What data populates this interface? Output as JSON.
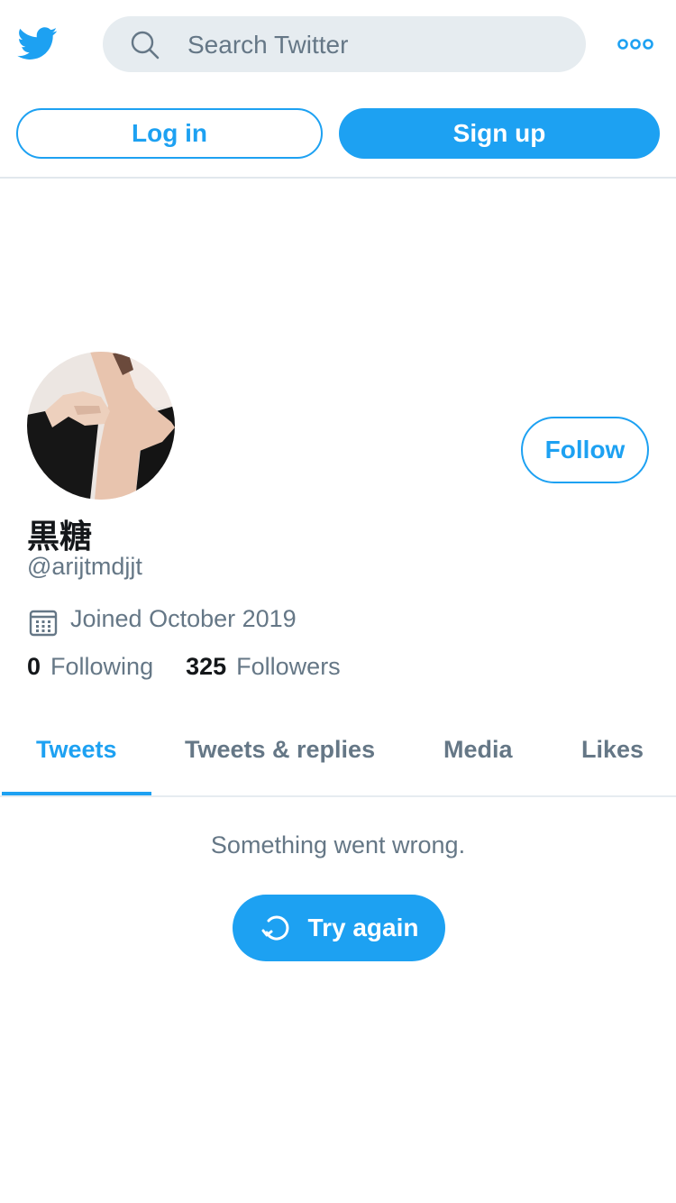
{
  "header": {
    "logo_icon": "twitter-bird-icon",
    "search_placeholder": "Search Twitter",
    "more_icon": "more-dots-icon",
    "accent_color": "#1da1f2"
  },
  "auth": {
    "login_label": "Log in",
    "signup_label": "Sign up"
  },
  "profile": {
    "display_name": "黒糖",
    "handle": "@arijtmdjjt",
    "joined": "Joined October 2019",
    "follow_label": "Follow",
    "following_count": "0",
    "following_label": "Following",
    "followers_count": "325",
    "followers_label": "Followers"
  },
  "tabs": [
    {
      "label": "Tweets",
      "active": true
    },
    {
      "label": "Tweets & replies",
      "active": false
    },
    {
      "label": "Media",
      "active": false
    },
    {
      "label": "Likes",
      "active": false
    }
  ],
  "timeline": {
    "error_message": "Something went wrong.",
    "retry_label": "Try again"
  }
}
